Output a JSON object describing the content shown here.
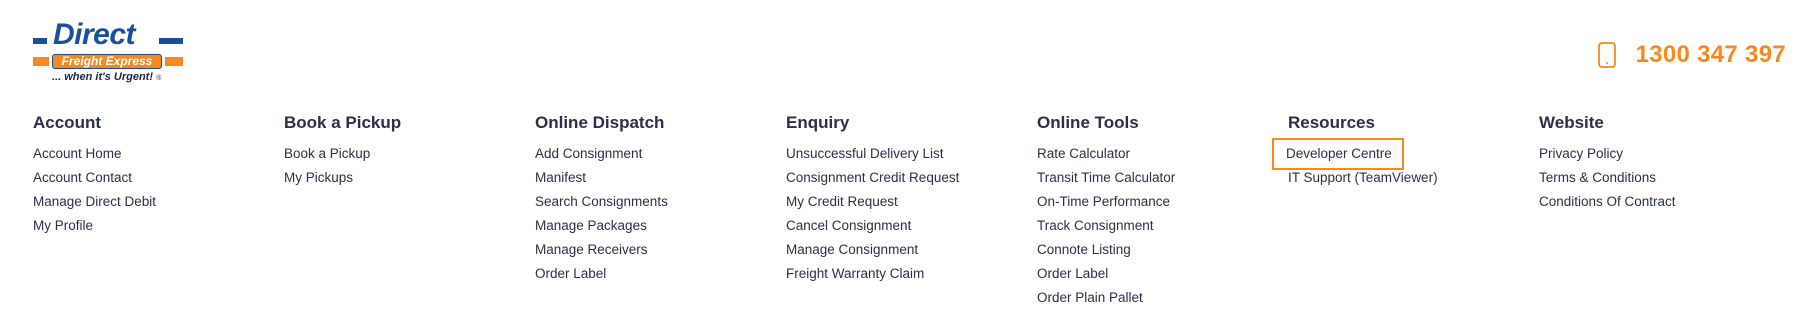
{
  "brand": {
    "logo_word": "Direct",
    "logo_band_text": "Freight Express",
    "logo_tagline": "... when it's Urgent!",
    "logo_registered": "®",
    "blue": "#1a4ea0",
    "orange": "#f7891f"
  },
  "contact": {
    "phone_icon": "mobile-phone-icon",
    "phone_number": "1300 347 397"
  },
  "columns": [
    {
      "title": "Account",
      "items": [
        "Account Home",
        "Account Contact",
        "Manage Direct Debit",
        "My Profile"
      ]
    },
    {
      "title": "Book a Pickup",
      "items": [
        "Book a Pickup",
        "My Pickups"
      ]
    },
    {
      "title": "Online Dispatch",
      "items": [
        "Add Consignment",
        "Manifest",
        "Search Consignments",
        "Manage Packages",
        "Manage Receivers",
        "Order Label"
      ]
    },
    {
      "title": "Enquiry",
      "items": [
        "Unsuccessful Delivery List",
        "Consignment Credit Request",
        "My Credit Request",
        "Cancel Consignment",
        "Manage Consignment",
        "Freight Warranty Claim"
      ]
    },
    {
      "title": "Online Tools",
      "items": [
        "Rate Calculator",
        "Transit Time Calculator",
        "On-Time Performance",
        "Track Consignment",
        "Connote Listing",
        "Order Label",
        "Order Plain Pallet"
      ]
    },
    {
      "title": "Resources",
      "items": [
        "Developer Centre",
        "IT Support (TeamViewer)"
      ],
      "highlighted_item": "Developer Centre"
    },
    {
      "title": "Website",
      "items": [
        "Privacy Policy",
        "Terms & Conditions",
        "Conditions Of Contract"
      ]
    }
  ]
}
